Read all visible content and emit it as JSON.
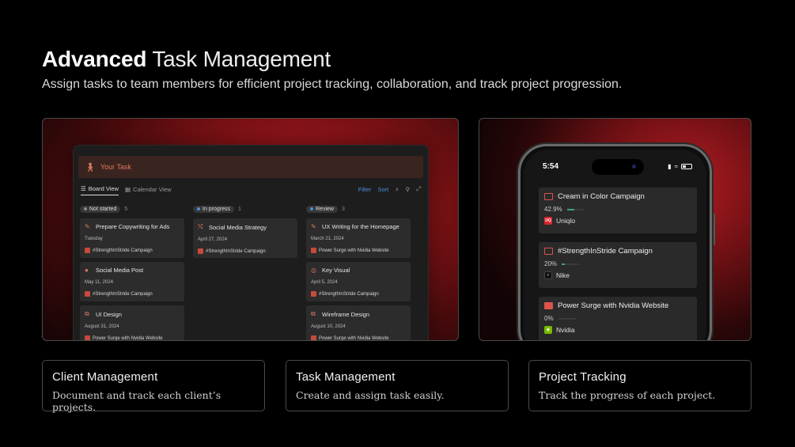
{
  "hero": {
    "title_bold": "Advanced",
    "title_rest": "Task Management",
    "subtitle": "Assign tasks to team members for efficient project tracking,  collaboration, and track project progression."
  },
  "board": {
    "header": "Your Task",
    "views": [
      "Board View",
      "Calendar View"
    ],
    "tools": {
      "filter": "Filter",
      "sort": "Sort"
    },
    "columns": [
      {
        "status": "Not started",
        "count": "5",
        "dot_color": "#8a8a8a",
        "cards": [
          {
            "title": "Prepare Copywriting for Ads",
            "date": "Tuesday",
            "project": "#StrengthInStride Campaign"
          },
          {
            "title": "Social Media Post",
            "date": "May 11, 2024",
            "project": "#StrengthInStride Campaign"
          },
          {
            "title": "UI Design",
            "date": "August 31, 2024",
            "project": "Power Surge with Nvidia Website"
          }
        ]
      },
      {
        "status": "In progress",
        "count": "1",
        "dot_color": "#4a90d9",
        "cards": [
          {
            "title": "Social Media Strategy",
            "date": "April 27, 2024",
            "project": "#StrengthInStride Campaign"
          }
        ]
      },
      {
        "status": "Review",
        "count": "3",
        "dot_color": "#4a90d9",
        "cards": [
          {
            "title": "UX Writing for the Homepage",
            "date": "March 21, 2024",
            "project": "Power Surge with Nvidia Website"
          },
          {
            "title": "Key Visual",
            "date": "April 5, 2024",
            "project": "#StrengthInStride Campaign"
          },
          {
            "title": "Wireframe Design",
            "date": "August 10, 2024",
            "project": "Power Surge with Nvidia Website"
          }
        ]
      }
    ]
  },
  "phone": {
    "time": "5:54",
    "projects": [
      {
        "title": "Cream in Color Campaign",
        "progress": "42.9%",
        "progress_value": 0.429,
        "client": "Uniqlo",
        "logo_color": "#d8262f"
      },
      {
        "title": "#StrengthInStride Campaign",
        "progress": "20%",
        "progress_value": 0.2,
        "client": "Nike",
        "logo_color": "#111111"
      },
      {
        "title": "Power Surge with Nvidia Website",
        "progress": "0%",
        "progress_value": 0,
        "client": "Nvidia",
        "logo_color": "#76b900"
      }
    ]
  },
  "features": [
    {
      "title": "Client Management",
      "desc": "Document and track each client’s projects."
    },
    {
      "title": "Task Management",
      "desc": "Create and assign task easily."
    },
    {
      "title": "Project Tracking",
      "desc": "Track the progress of each project."
    }
  ]
}
